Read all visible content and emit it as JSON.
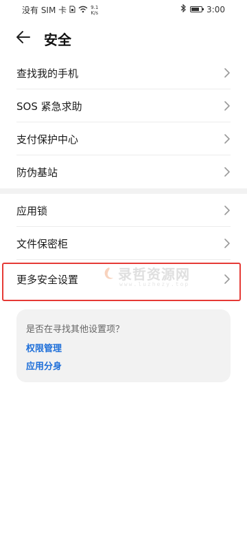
{
  "status_bar": {
    "carrier": "没有 SIM 卡",
    "net_speed_value": "9.1",
    "net_speed_unit": "K/s",
    "time": "3:00",
    "battery_level": 0.8
  },
  "header": {
    "title": "安全"
  },
  "group1": {
    "items": [
      {
        "label": "查找我的手机"
      },
      {
        "label": "SOS 紧急求助"
      },
      {
        "label": "支付保护中心"
      },
      {
        "label": "防伪基站"
      }
    ]
  },
  "group2": {
    "items": [
      {
        "label": "应用锁"
      },
      {
        "label": "文件保密柜"
      },
      {
        "label": "更多安全设置"
      }
    ]
  },
  "watermark": {
    "main": "录哲资源网",
    "sub": "www.luzhezy.top"
  },
  "suggestions": {
    "question": "是否在寻找其他设置项？",
    "links": [
      {
        "label": "权限管理"
      },
      {
        "label": "应用分身"
      }
    ]
  },
  "colors": {
    "link": "#1e6fd9",
    "highlight": "#e53935",
    "card_bg": "#f2f2f2"
  }
}
